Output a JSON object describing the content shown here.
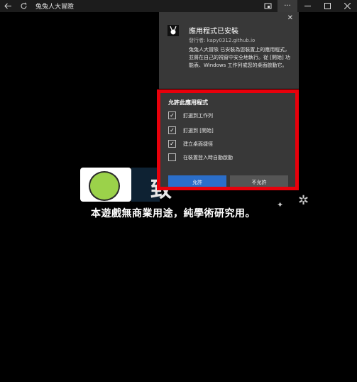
{
  "titlebar": {
    "title": "兔兔人大冒險"
  },
  "content": {
    "banner_text": "致",
    "disclaimer": "本遊戲無商業用途，純學術研究用。"
  },
  "popup": {
    "title": "應用程式已安裝",
    "publisher": "發行者: kapy0312.github.io",
    "body": "兔兔人大冒險 已安裝為您裝置上的應用程式，並將在自己的視窗中安全地執行。從 [開始] 功能表、Windows 工作列或您的桌面啟動它。"
  },
  "permissions": {
    "heading": "允許此應用程式",
    "options": [
      {
        "label": "釘選到工作列",
        "checked": true
      },
      {
        "label": "釘選到 [開始]",
        "checked": true
      },
      {
        "label": "建立桌面捷徑",
        "checked": true
      },
      {
        "label": "在裝置登入時自動啟動",
        "checked": false
      }
    ],
    "allow_label": "允許",
    "deny_label": "不允許"
  },
  "colors": {
    "highlight": "#e8000b",
    "allow_button": "#2b6ec9"
  }
}
